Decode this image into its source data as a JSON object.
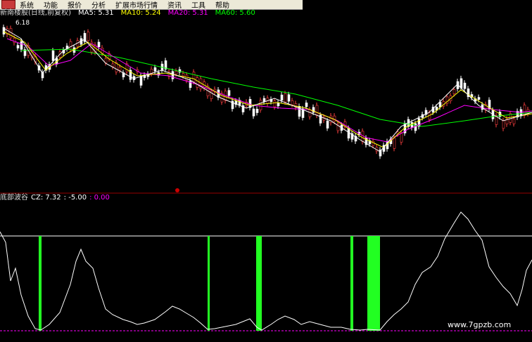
{
  "menu": {
    "items": [
      "系统",
      "功能",
      "报价",
      "分析",
      "扩展市场行情",
      "资讯",
      "工具",
      "帮助"
    ]
  },
  "price_panel": {
    "stock_title": "新南楼股(日线,前复权)",
    "ma5_label": "MA5: 5.31",
    "ma10_label": "MA10: 5.24",
    "ma20_label": "MA20: 5.31",
    "ma60_label": "MA60: 5.60",
    "high_marker": "6.18"
  },
  "indicator_panel": {
    "name": "底部波谷",
    "cz_label": "CZ: 7.32",
    "value2": ": -5.00",
    "value3": ": 0.00"
  },
  "colors": {
    "ma5": "#ffffff",
    "ma10": "#ffff00",
    "ma20": "#ff00ff",
    "ma60": "#00ff00",
    "candle_up": "#ff4040",
    "candle_down": "#ffffff",
    "signal_bar": "#22ff22",
    "divider": "#990000"
  },
  "watermark": "www.7gpzb.com"
}
